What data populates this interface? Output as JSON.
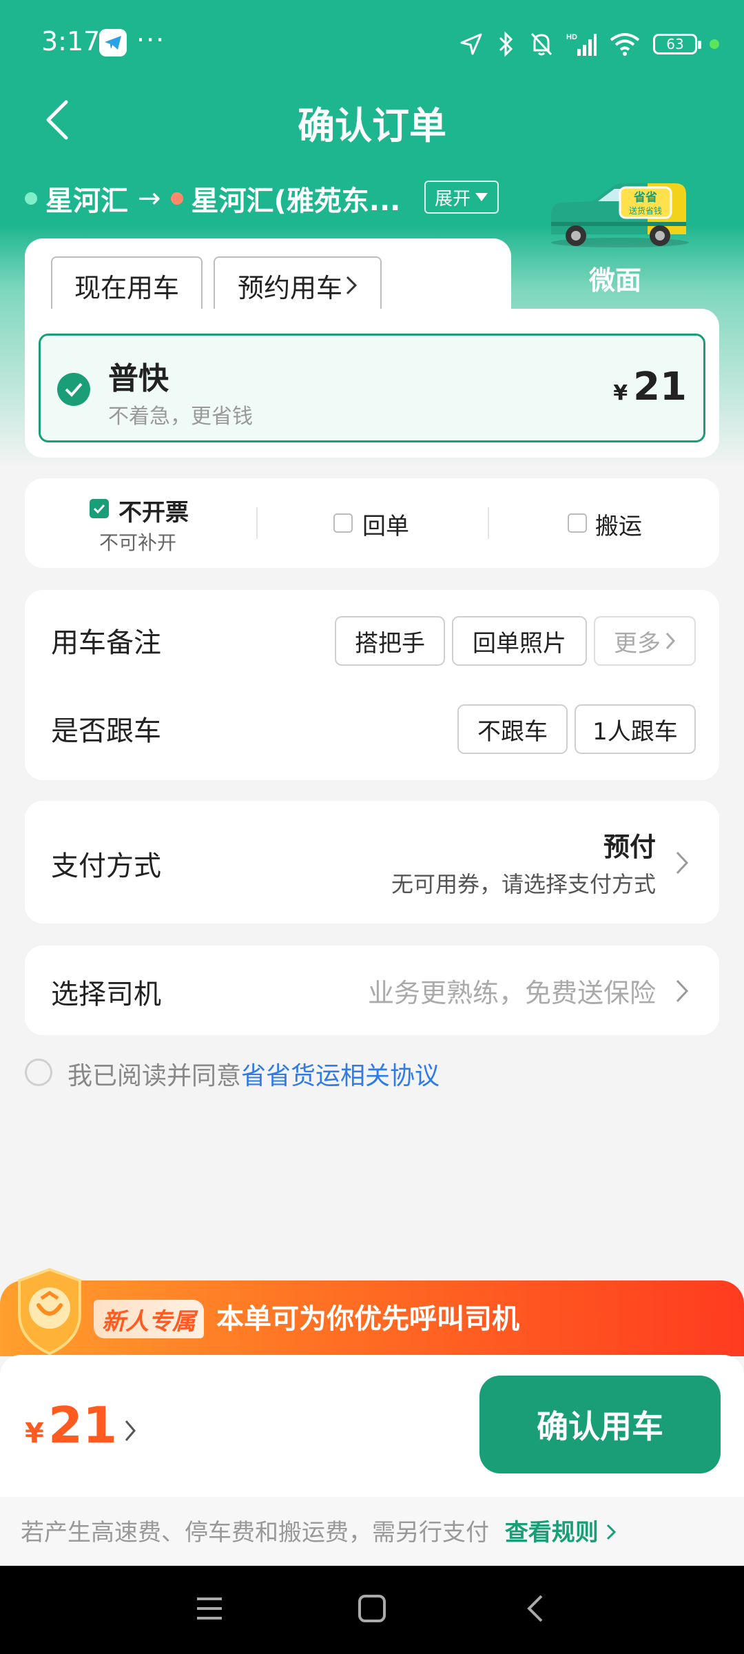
{
  "status_bar": {
    "time": "3:17",
    "dots": "···",
    "battery": "63"
  },
  "header": {
    "title": "确认订单"
  },
  "route": {
    "from": "星河汇",
    "arrow": "→",
    "to": "星河汇(雅苑东...",
    "expand_label": "展开"
  },
  "vehicle": {
    "tab_label": "微面",
    "van_sticker": "省省 送货省钱"
  },
  "time_options": {
    "now": "现在用车",
    "reserve": "预约用车"
  },
  "service_option": {
    "name": "普快",
    "desc": "不着急，更省钱",
    "currency": "¥",
    "price": "21"
  },
  "extras": {
    "no_invoice": "不开票",
    "no_invoice_sub": "不可补开",
    "receipt": "回单",
    "carry": "搬运"
  },
  "remarks": {
    "label": "用车备注",
    "tags": [
      "搭把手",
      "回单照片",
      "更多"
    ],
    "follow_label": "是否跟车",
    "follow_options": [
      "不跟车",
      "1人跟车"
    ]
  },
  "payment": {
    "label": "支付方式",
    "value": "预付",
    "sub": "无可用券，请选择支付方式"
  },
  "driver": {
    "label": "选择司机",
    "hint": "业务更熟练，免费送保险"
  },
  "agreement": {
    "prefix": "我已阅读并同意",
    "link": "省省货运相关协议"
  },
  "promo": {
    "badge": "新人专属",
    "text": "本单可为你优先呼叫司机"
  },
  "bottom": {
    "currency": "¥",
    "total": "21",
    "confirm_label": "确认用车",
    "fee_note": "若产生高速费、停车费和搬运费，需另行支付",
    "rules_link": "查看规则"
  },
  "colors": {
    "brand": "#1db68e",
    "accent": "#1a9e78",
    "promo": "#ff5a1f",
    "link": "#2f7be8"
  }
}
